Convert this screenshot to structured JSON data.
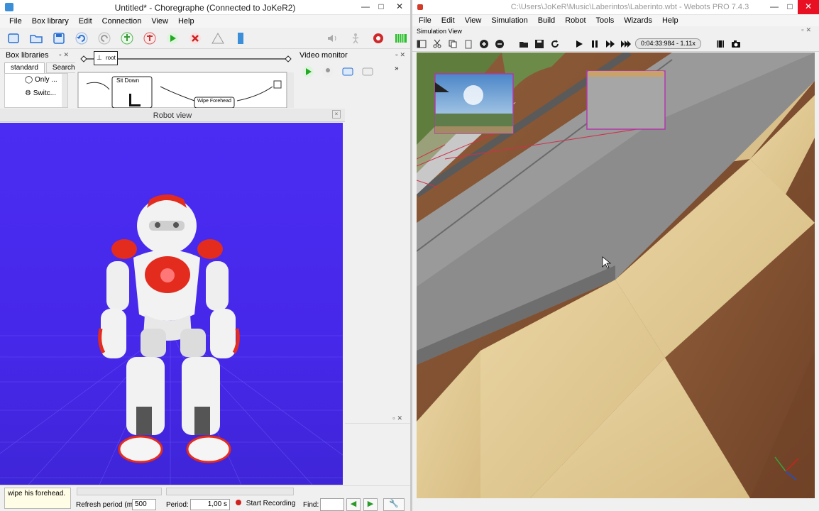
{
  "choregraphe": {
    "title": "Untitled* - Choregraphe (Connected to JoKeR2)",
    "window_controls": {
      "minimize": "—",
      "maximize": "□",
      "close": "✕"
    },
    "menu": [
      "File",
      "Box library",
      "Edit",
      "Connection",
      "View",
      "Help"
    ],
    "box_libraries": {
      "title": "Box libraries",
      "tabs": [
        "standard",
        "Search"
      ],
      "items": [
        "Only ...",
        "Switc..."
      ]
    },
    "flow": {
      "root_label": "root",
      "boxes": [
        "Sit Down",
        "Wipe Forehead"
      ]
    },
    "video_monitor": {
      "title": "Video monitor"
    },
    "robot_view": {
      "title": "Robot view"
    },
    "status": {
      "description": "wipe his forehead.",
      "refresh_label": "Refresh period (ms):",
      "refresh_value": "500",
      "period_label": "Period:",
      "period_value": "1,00 s",
      "record_label": "Start Recording",
      "find_label": "Find:"
    },
    "colors": {
      "robot_bg": "#4a2bf0",
      "accent_red": "#d8261c"
    }
  },
  "webots": {
    "title": "C:\\Users\\JoKeR\\Music\\Laberintos\\Laberinto.wbt - Webots PRO 7.4.3",
    "window_controls": {
      "minimize": "—",
      "maximize": "□",
      "close": "✕"
    },
    "menu": [
      "File",
      "Edit",
      "View",
      "Simulation",
      "Build",
      "Robot",
      "Tools",
      "Wizards",
      "Help"
    ],
    "simulation_view": {
      "title": "Simulation View"
    },
    "clock": "0:04:33:984 - 1.11x"
  }
}
